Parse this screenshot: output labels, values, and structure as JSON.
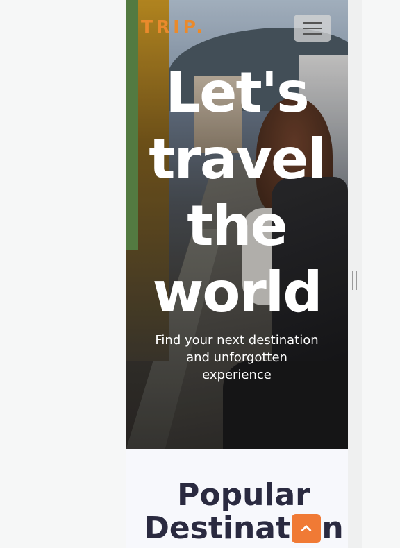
{
  "brand": {
    "logo_text": "TRIP",
    "logo_dot": "."
  },
  "nav": {
    "menu_icon": "hamburger-menu-icon"
  },
  "hero": {
    "headline_lines": [
      "Let's",
      "travel",
      "the",
      "world"
    ],
    "subtitle": "Find your next destination and unforgotten experience"
  },
  "section": {
    "title_line1": "Popular",
    "title_line2": "Destination"
  },
  "back_to_top": {
    "icon": "chevron-up-icon"
  },
  "colors": {
    "accent": "#f07a35",
    "logo": "#e98a2c",
    "heading": "#2a2a40"
  }
}
